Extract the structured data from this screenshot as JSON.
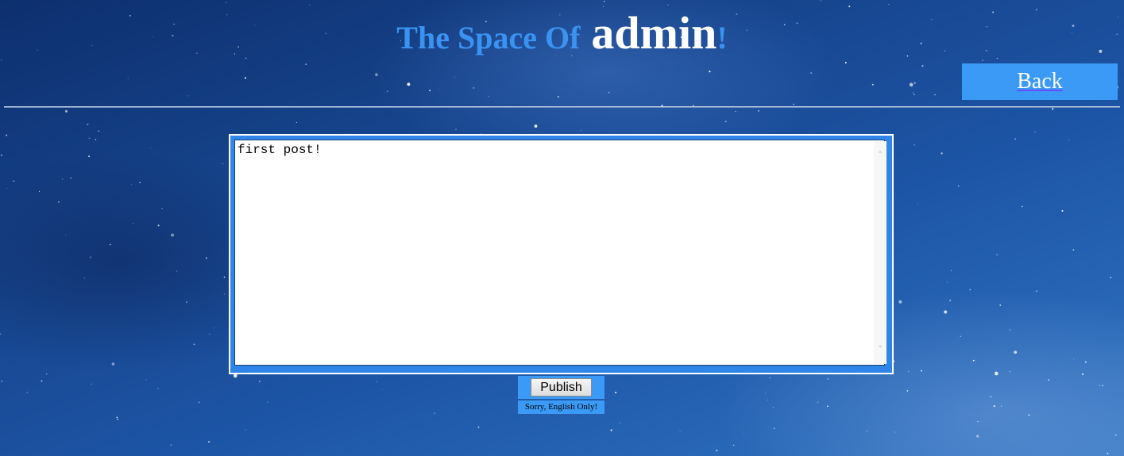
{
  "header": {
    "title_prefix": "The Space Of",
    "username": "admin",
    "title_suffix": "!"
  },
  "nav": {
    "back_label": "Back"
  },
  "editor": {
    "value": "first post!",
    "scroll_up_glyph": "˄",
    "scroll_down_glyph": "˅"
  },
  "actions": {
    "publish_label": "Publish",
    "notice": "Sorry, English Only!"
  },
  "colors": {
    "accent": "#3a9af5",
    "title_blue": "#3a93f0",
    "background": "#17468f"
  }
}
